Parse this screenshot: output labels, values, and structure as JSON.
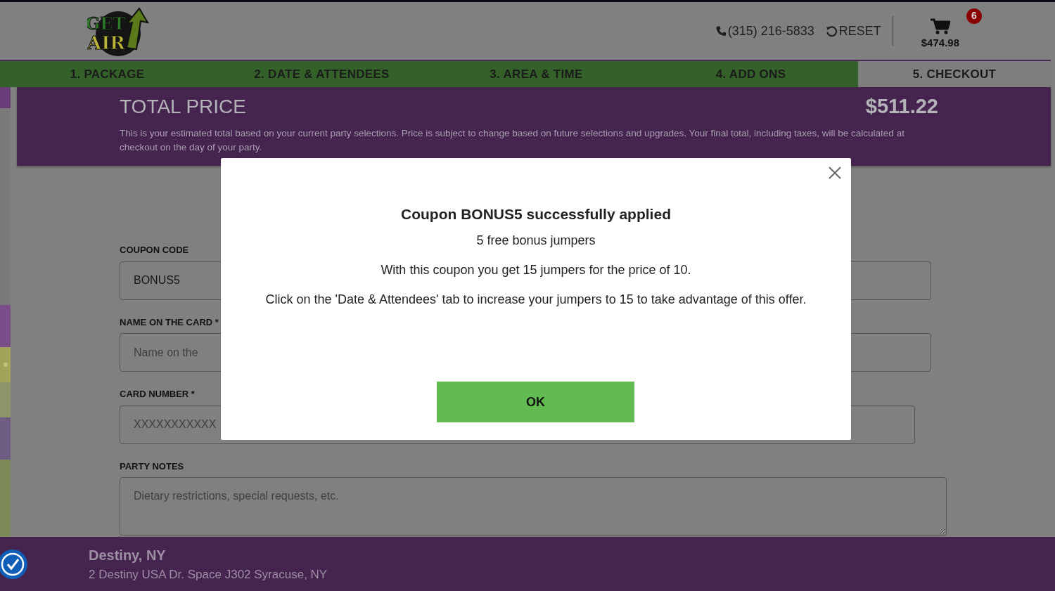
{
  "header": {
    "logo": {
      "top": "GET",
      "bottom": "AIR"
    },
    "phone": "(315) 216-5833",
    "reset": "RESET",
    "cart_count": "6",
    "cart_total": "$474.98"
  },
  "tabs": [
    {
      "label": "1. PACKAGE",
      "selected": false
    },
    {
      "label": "2. DATE & ATTENDEES",
      "selected": false
    },
    {
      "label": "3. AREA & TIME",
      "selected": false
    },
    {
      "label": "4. ADD ONS",
      "selected": false
    },
    {
      "label": "5. CHECKOUT",
      "selected": true
    }
  ],
  "total": {
    "title": "TOTAL PRICE",
    "amount": "$511.22",
    "note": "This is your estimated total based on your current party selections. Price is subject to change based on future selections and upgrades. Your final total, including taxes, will be calculated at checkout on the day of your party."
  },
  "form": [
    {
      "kind": "input",
      "label": "COUPON CODE",
      "value": "BONUS5"
    },
    {
      "kind": "input",
      "label": "NAME ON THE CARD *",
      "placeholder": "Name on the"
    },
    {
      "kind": "input",
      "label": "CARD NUMBER *",
      "placeholder": "XXXXXXXXXXX"
    },
    {
      "kind": "textarea",
      "label": "PARTY NOTES",
      "placeholder": "Dietary restrictions, special requests, etc."
    }
  ],
  "modal": {
    "title": "Coupon BONUS5 successfully applied",
    "subtitle": "5 free bonus jumpers",
    "lines": [
      "With this coupon you get 15 jumpers for the price of 10.",
      "Click on the 'Date & Attendees' tab to increase your jumpers to 15 to take advantage of this offer."
    ],
    "button": "OK"
  },
  "footer": {
    "name": "Destiny, NY",
    "address": "2 Destiny USA Dr. Space J302 Syracuse, NY"
  }
}
